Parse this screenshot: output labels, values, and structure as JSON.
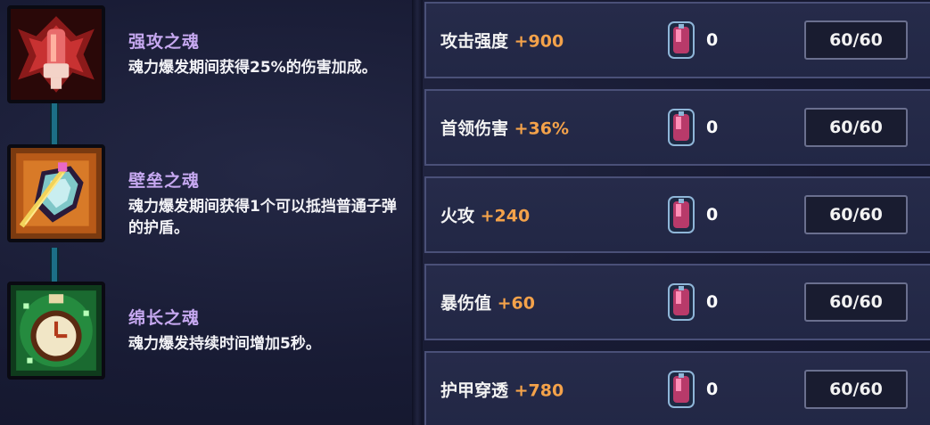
{
  "souls": [
    {
      "icon": "fist-soul-icon",
      "title": "强攻之魂",
      "desc": "魂力爆发期间获得25%的伤害加成。"
    },
    {
      "icon": "shield-soul-icon",
      "title": "壁垒之魂",
      "desc": "魂力爆发期间获得1个可以抵挡普通子弹的护盾。"
    },
    {
      "icon": "stopwatch-soul-icon",
      "title": "绵长之魂",
      "desc": "魂力爆发持续时间增加5秒。"
    }
  ],
  "stats": [
    {
      "name": "攻击强度",
      "bonus": "+900",
      "gem_count": "0",
      "level": "60/60"
    },
    {
      "name": "首领伤害",
      "bonus": "+36%",
      "gem_count": "0",
      "level": "60/60"
    },
    {
      "name": "火攻",
      "bonus": "+240",
      "gem_count": "0",
      "level": "60/60"
    },
    {
      "name": "暴伤值",
      "bonus": "+60",
      "gem_count": "0",
      "level": "60/60"
    },
    {
      "name": "护甲穿透",
      "bonus": "+780",
      "gem_count": "0",
      "level": "60/60"
    }
  ],
  "colors": {
    "accent_title": "#c6a8f0",
    "bonus": "#f4a24a",
    "connector": "#1c6f86"
  }
}
